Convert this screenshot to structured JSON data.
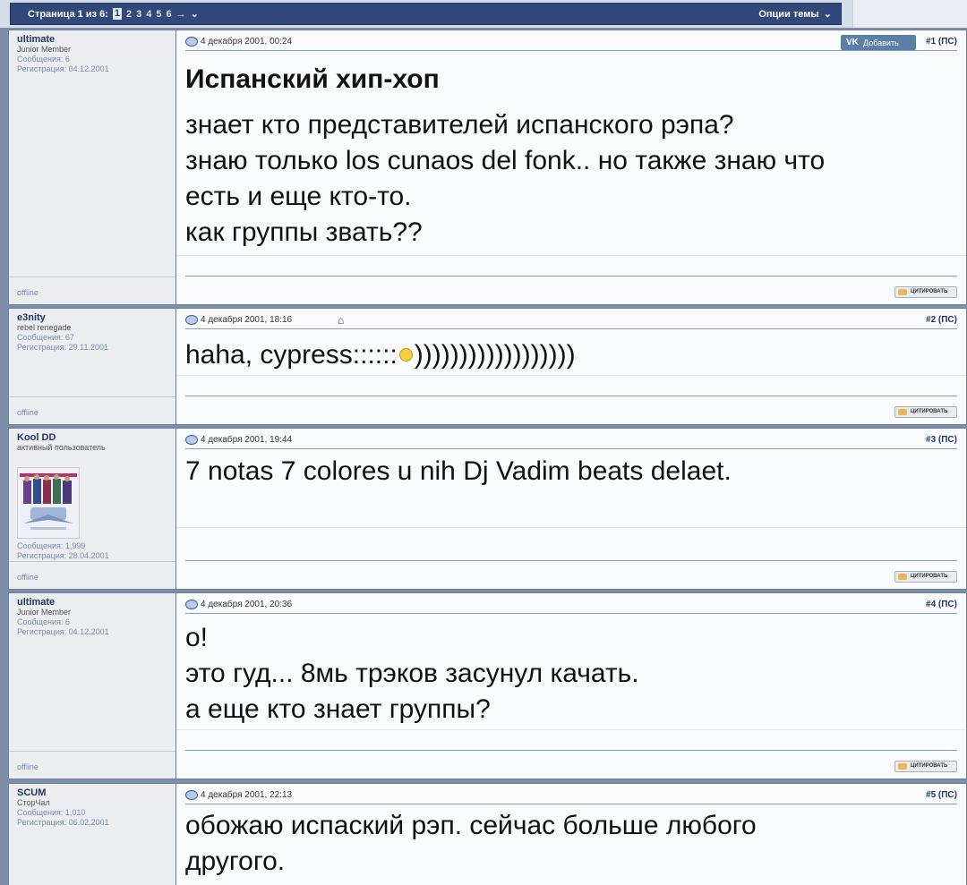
{
  "pager": {
    "label": "Страница 1 из 6:",
    "current": "1",
    "pages": [
      "2",
      "3",
      "4",
      "5",
      "6"
    ],
    "next": "→",
    "dropdown": "⌄",
    "options": "Опции темы",
    "options_caret": "⌄"
  },
  "posts": [
    {
      "user": {
        "name": "ultimate",
        "title": "Junior Member",
        "posts": "Сообщения: 6",
        "reg": "Регистрация: 04.12.2001",
        "status": "offline"
      },
      "date": "4 декабря 2001, 00:24",
      "num": "#1 (ПС)",
      "vk": {
        "logo": "VK",
        "label": "Добавить"
      },
      "title": "Испанский хип-хоп",
      "lines": [
        "знает кто представителей испанского рэпа?",
        "знаю только los cunaos del fonk.. но также знаю что",
        "есть и еще кто-то.",
        "как группы звать??"
      ],
      "quote": "ЦИТИРОВАТЬ"
    },
    {
      "user": {
        "name": "e3nity",
        "title": "rebel renegade",
        "posts": "Сообщения: 67",
        "reg": "Регистрация: 29.11.2001",
        "status": "offline"
      },
      "date": "4 декабря 2001, 18:16",
      "num": "#2 (ПС)",
      "home_icon": "⌂",
      "text_before": "haha, cypress::::::",
      "text_after": "))))))))))))))))))",
      "quote": "ЦИТИРОВАТЬ"
    },
    {
      "user": {
        "name": "Kool DD",
        "title": "активный пользователь",
        "posts": "Сообщения: 1,999",
        "reg": "Регистрация: 28.04.2001",
        "status": "offline"
      },
      "date": "4 декабря 2001, 19:44",
      "num": "#3 (ПС)",
      "lines": [
        "7 notas 7 colores u nih Dj Vadim beats delaet."
      ],
      "quote": "ЦИТИРОВАТЬ"
    },
    {
      "user": {
        "name": "ultimate",
        "title": "Junior Member",
        "posts": "Сообщения: 6",
        "reg": "Регистрация: 04.12.2001",
        "status": "offline"
      },
      "date": "4 декабря 2001, 20:36",
      "num": "#4 (ПС)",
      "lines": [
        "о!",
        "это гуд... 8мь трэков засунул качать.",
        "а еще кто знает группы?"
      ],
      "quote": "ЦИТИРОВАТЬ"
    },
    {
      "user": {
        "name": "SCUM",
        "title": "СторЧал",
        "posts": "Сообщения: 1,010",
        "reg": "Регистрация: 06.02.2001"
      },
      "date": "4 декабря 2001, 22:13",
      "num": "#5 (ПС)",
      "lines": [
        "обожаю испаский рэп. сейчас больше любого",
        "другого."
      ]
    }
  ]
}
